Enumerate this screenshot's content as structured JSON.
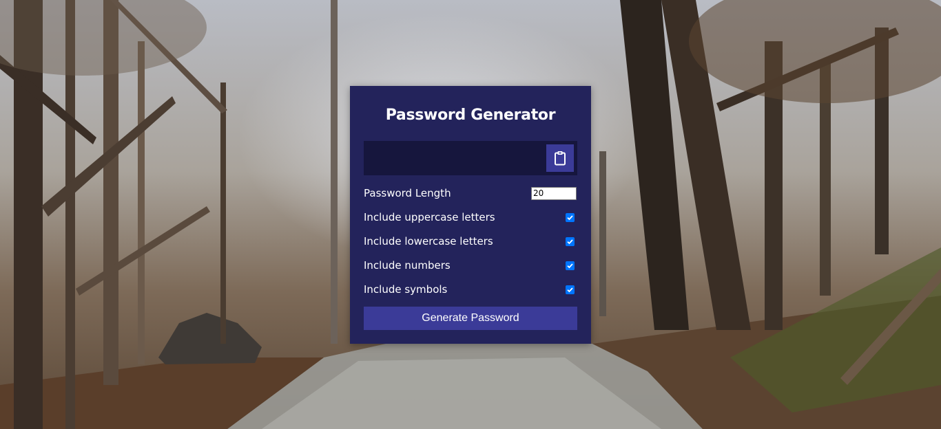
{
  "app": {
    "title": "Password Generator"
  },
  "result": {
    "value": "",
    "copy_icon": "clipboard-icon"
  },
  "settings": {
    "length": {
      "label": "Password Length",
      "value": "20"
    },
    "uppercase": {
      "label": "Include uppercase letters",
      "checked": true
    },
    "lowercase": {
      "label": "Include lowercase letters",
      "checked": true
    },
    "numbers": {
      "label": "Include numbers",
      "checked": true
    },
    "symbols": {
      "label": "Include symbols",
      "checked": true
    }
  },
  "generate_button": {
    "label": "Generate Password"
  },
  "colors": {
    "card": "#23235b",
    "result_bg": "#16163d",
    "button": "#3b3b98",
    "checkbox": "#0075ff"
  }
}
